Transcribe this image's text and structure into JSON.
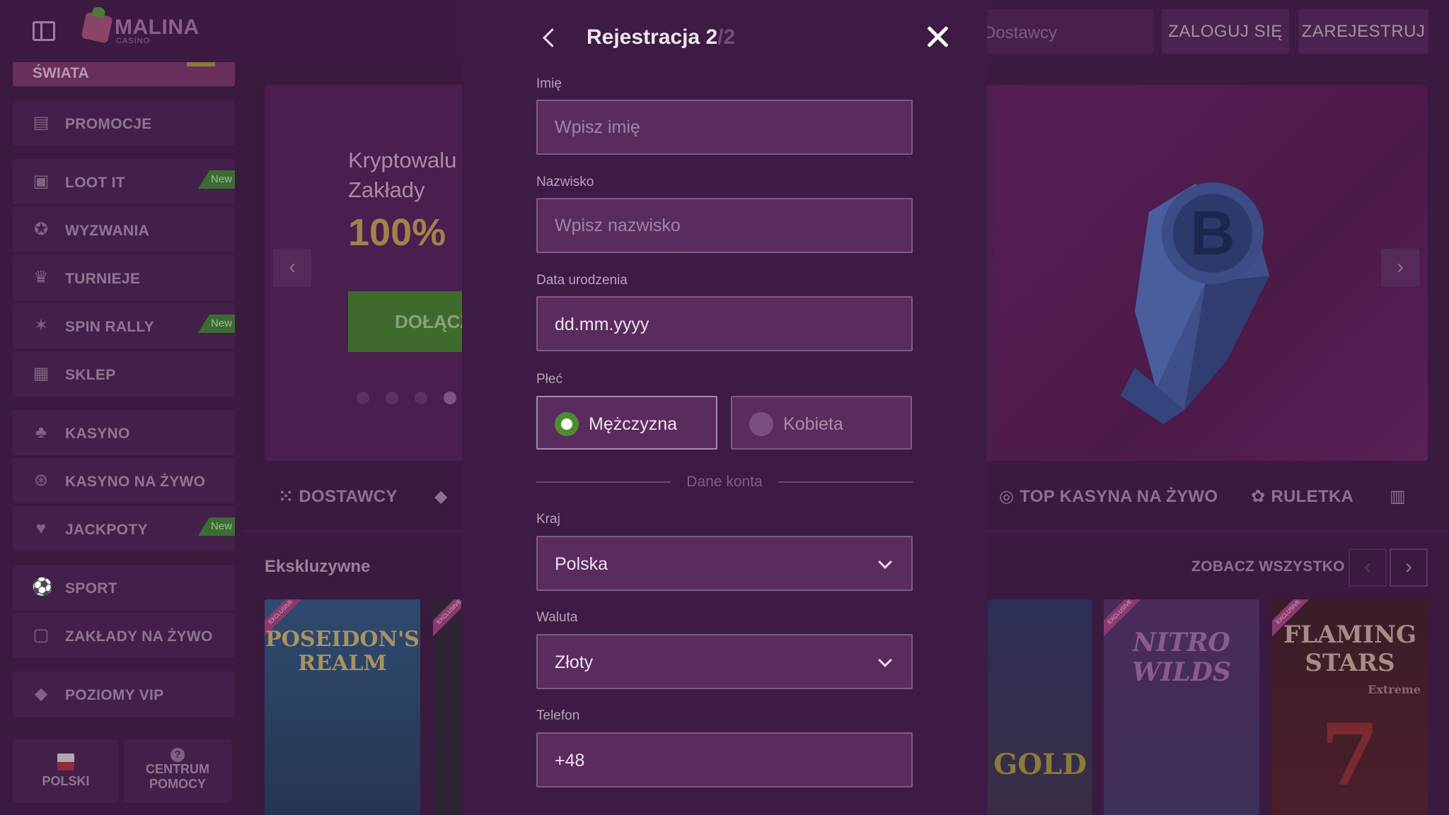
{
  "header": {
    "brand": "MALINA",
    "brand_sub": "CASINO",
    "search_placeholder": "Dostawcy",
    "login_label": "ZALOGUJ SIĘ",
    "register_label": "ZAREJESTRUJ"
  },
  "sidebar": {
    "top_item": "ŚWIATA",
    "items": [
      {
        "label": "PROMOCJE",
        "icon": "gift-icon",
        "badge": ""
      },
      {
        "label": "LOOT IT",
        "icon": "loot-box-icon",
        "badge": "New"
      },
      {
        "label": "WYZWANIA",
        "icon": "medal-icon",
        "badge": ""
      },
      {
        "label": "TURNIEJE",
        "icon": "trophy-icon",
        "badge": ""
      },
      {
        "label": "SPIN RALLY",
        "icon": "rally-icon",
        "badge": "New"
      },
      {
        "label": "SKLEP",
        "icon": "shop-icon",
        "badge": ""
      },
      {
        "label": "KASYNO",
        "icon": "cherries-icon",
        "badge": ""
      },
      {
        "label": "KASYNO NA ŻYWO",
        "icon": "chip-icon",
        "badge": ""
      },
      {
        "label": "JACKPOTY",
        "icon": "jackpot-icon",
        "badge": "New"
      },
      {
        "label": "SPORT",
        "icon": "soccer-ball-icon",
        "badge": ""
      },
      {
        "label": "ZAKŁADY NA ŻYWO",
        "icon": "live-bet-icon",
        "badge": ""
      },
      {
        "label": "POZIOMY VIP",
        "icon": "diamond-icon",
        "badge": ""
      }
    ],
    "language_label": "POLSKI",
    "help_label_1": "CENTRUM",
    "help_label_2": "POMOCY"
  },
  "banner": {
    "line1": "Kryptowalu",
    "line2": "Zakłady",
    "big": "100%",
    "cta": "DOŁĄCZ"
  },
  "categories": [
    {
      "label": "DOSTAWCY",
      "icon": "grid-icon"
    },
    {
      "label": "",
      "icon": "diamond-icon"
    },
    {
      "label": "TOP KASYNA NA ŻYWO",
      "icon": "chip-icon"
    },
    {
      "label": "RULETKA",
      "icon": "roulette-icon"
    }
  ],
  "games_section": {
    "title": "Ekskluzywne",
    "see_all": "ZOBACZ WSZYSTKO",
    "games": [
      {
        "title": "POSEIDON'S REALM",
        "ribbon": "EXCLUSIVE"
      },
      {
        "title": "",
        "ribbon": "EXCLUSIVE"
      },
      {
        "title": "GOLD",
        "ribbon": ""
      },
      {
        "title": "NITRO WILDS",
        "ribbon": "EXCLUSIVE"
      },
      {
        "title": "FLAMING STARS",
        "ribbon": "EXCLUSIVE",
        "subtitle": "Extreme"
      }
    ]
  },
  "modal": {
    "title": "Rejestracja 2",
    "step_total": "/2",
    "first_name": {
      "label": "Imię",
      "placeholder": "Wpisz imię"
    },
    "last_name": {
      "label": "Nazwisko",
      "placeholder": "Wpisz nazwisko"
    },
    "birth_date": {
      "label": "Data urodzenia",
      "value": "dd.mm.yyyy"
    },
    "gender": {
      "label": "Płeć",
      "options": [
        "Mężczyzna",
        "Kobieta"
      ],
      "selected": "Mężczyzna"
    },
    "account_divider": "Dane konta",
    "country": {
      "label": "Kraj",
      "value": "Polska"
    },
    "currency": {
      "label": "Waluta",
      "value": "Złoty"
    },
    "phone": {
      "label": "Telefon",
      "value": "+48"
    }
  },
  "colors": {
    "accent_green": "#4d8d2f",
    "modal_bg": "#3d1b44",
    "field_bg": "#5a2c5e"
  }
}
